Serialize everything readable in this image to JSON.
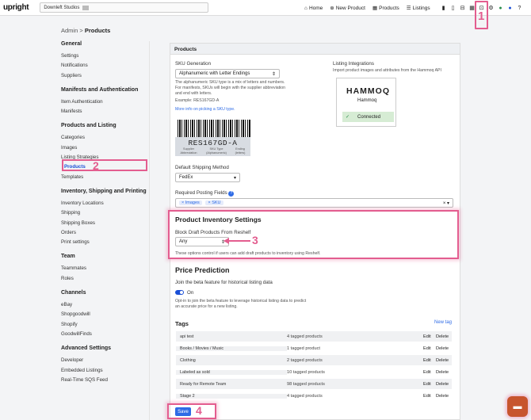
{
  "topbar": {
    "logo": "upright",
    "store_name": "Downleft Studios",
    "nav": [
      {
        "icon": "home-icon",
        "glyph": "⌂",
        "label": "Home"
      },
      {
        "icon": "plus-circle-icon",
        "glyph": "⊕",
        "label": "New Product"
      },
      {
        "icon": "grid-icon",
        "glyph": "▦",
        "label": "Products"
      },
      {
        "icon": "list-icon",
        "glyph": "☰",
        "label": "Listings"
      }
    ],
    "icons": [
      "clipboard-icon",
      "file-icon",
      "inbox-icon",
      "grid-icon",
      "cart-icon",
      "settings-icon",
      "info-icon",
      "bell-icon",
      "help-icon"
    ]
  },
  "breadcrumb": {
    "root": "Admin",
    "separator": ">",
    "current": "Products"
  },
  "sidebar": {
    "sections": [
      {
        "title": "General",
        "items": [
          "Settings",
          "Notifications",
          "Suppliers"
        ]
      },
      {
        "title": "Manifests and Authentication",
        "items": [
          "Item Authentication",
          "Manifests"
        ]
      },
      {
        "title": "Products and Listing",
        "items": [
          "Categories",
          "Images",
          "Listing Strategies",
          "Products",
          "Templates"
        ]
      },
      {
        "title": "Inventory, Shipping and Printing",
        "items": [
          "Inventory Locations",
          "Shipping",
          "Shipping Boxes",
          "Orders",
          "Print settings"
        ]
      },
      {
        "title": "Team",
        "items": [
          "Teammates",
          "Roles"
        ]
      },
      {
        "title": "Channels",
        "items": [
          "eBay",
          "Shopgoodwill",
          "Shopify",
          "GoodwillFinds"
        ]
      },
      {
        "title": "Advanced Settings",
        "items": [
          "Developer",
          "Embedded Listings",
          "Real-Time SQS Feed"
        ]
      }
    ],
    "selected": "Products"
  },
  "main": {
    "header": "Products",
    "sku": {
      "label": "SKU Generation",
      "value": "Alphanumeric with Letter Endings",
      "desc1": "The alphanumeric SKU type is a mix of letters and numbers.",
      "desc2": "For manifests, SKUs will begin with the supplier abbreviation",
      "desc3": "and end with letters.",
      "example": "Example: RES167GD-A",
      "more_link": "More info on picking a SKU type.",
      "barcode_text": "RES167GD-A",
      "parts": [
        "Supplier Abbreviation",
        "SKU Type (Alphanumeric)",
        "Ending (letters)"
      ]
    },
    "integrations": {
      "label": "Listing Integrations",
      "desc": "Import product images and attributes from the Hammoq API",
      "logo": "HAMMOQ",
      "name": "Hammoq",
      "status": "Connected",
      "status_icon": "check-icon"
    },
    "shipping": {
      "label": "Default Shipping Method",
      "value": "FedEx"
    },
    "posting": {
      "label": "Required Posting Fields",
      "chips": [
        "Images",
        "SKU"
      ]
    },
    "inventory": {
      "title": "Product Inventory Settings",
      "block_label": "Block Draft Products From Reshelf",
      "value": "Any",
      "desc": "These options control if users can add draft products to inventory using Reshelf."
    },
    "price": {
      "title": "Price Prediction",
      "join": "Join the beta feature for historical listing data",
      "toggle_label": "On",
      "toggle_on": true,
      "desc1": "Opt-in to join the beta feature to leverage historical listing data to predict",
      "desc2": "an accurate price for a new listing."
    },
    "tags": {
      "title": "Tags",
      "new_tag": "New tag",
      "edit": "Edit",
      "delete": "Delete",
      "rows": [
        {
          "name": "api test",
          "count": "4 tagged products"
        },
        {
          "name": "Books / Movies / Music",
          "count": "1 tagged product"
        },
        {
          "name": "Clothing",
          "count": "2 tagged products"
        },
        {
          "name": "Labeled as sold",
          "count": "10 tagged products"
        },
        {
          "name": "Ready for Remote Team",
          "count": "98 tagged products"
        },
        {
          "name": "Stage 2",
          "count": "4 tagged products"
        }
      ]
    },
    "save": "Save"
  },
  "annotations": [
    "1",
    "2",
    "3",
    "4"
  ],
  "colors": {
    "highlight": "#e35d8f",
    "accent": "#2e6be6",
    "chat": "#c7552e"
  }
}
